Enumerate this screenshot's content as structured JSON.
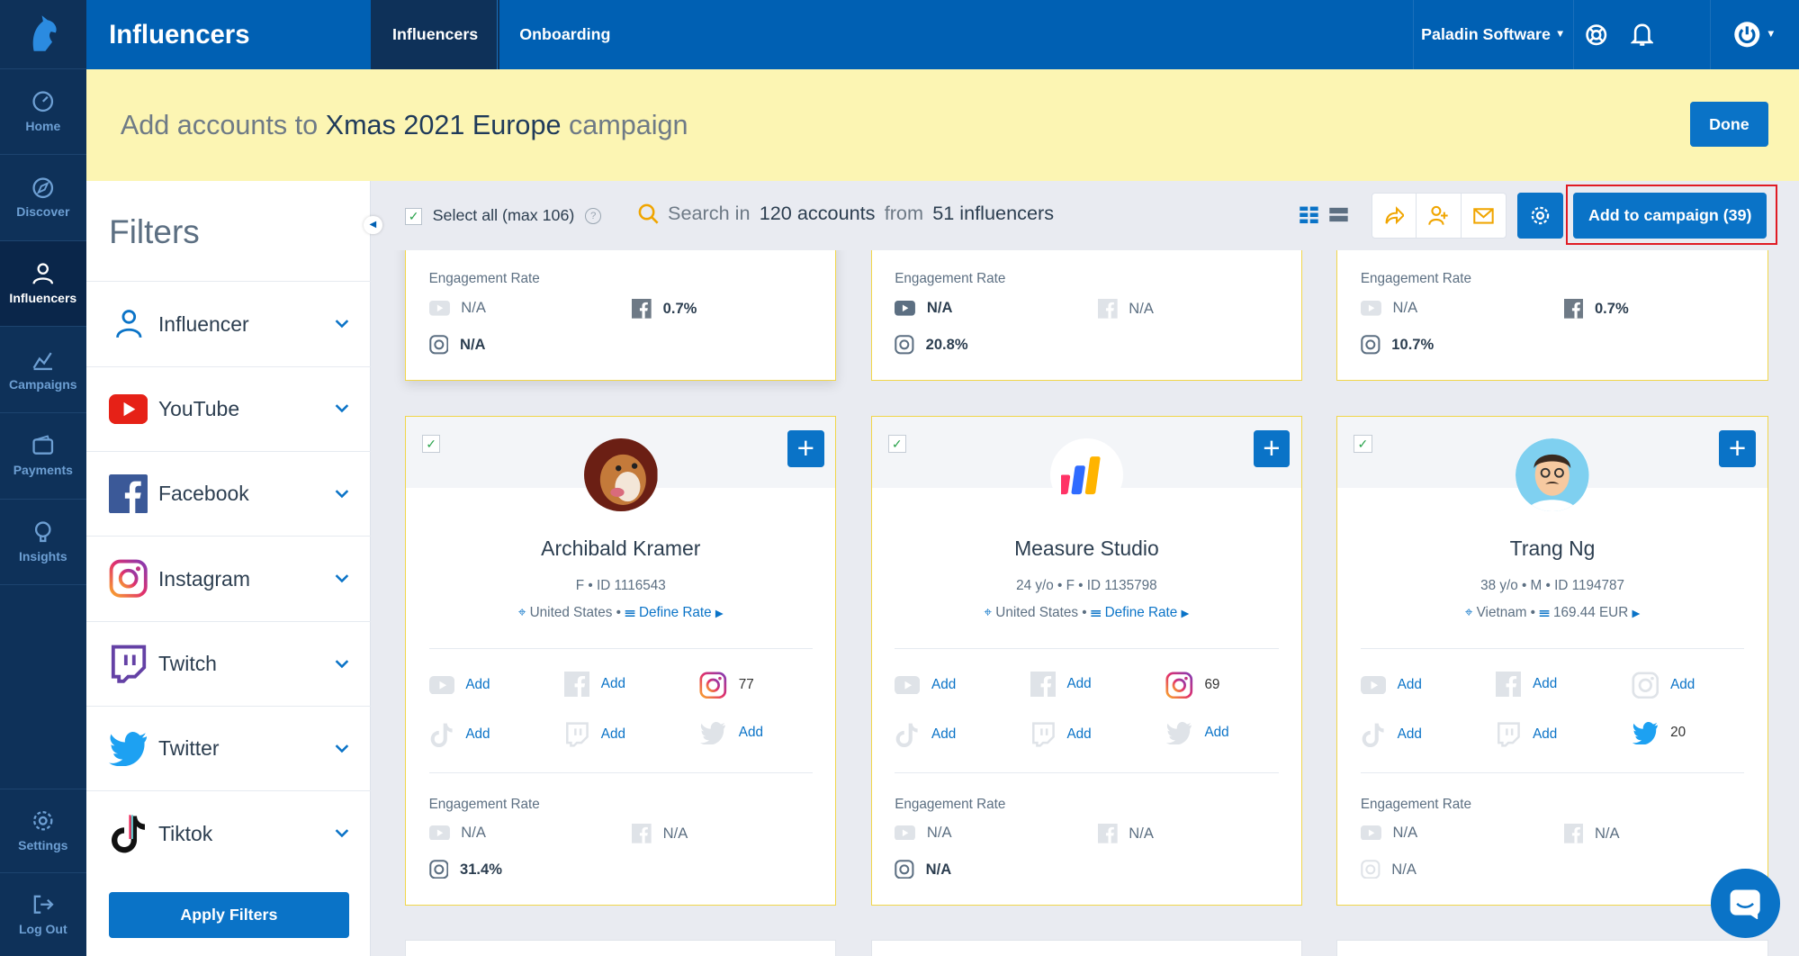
{
  "app": {
    "title": "Influencers"
  },
  "sidebar": {
    "items": [
      {
        "label": "Home",
        "icon": "gauge-icon"
      },
      {
        "label": "Discover",
        "icon": "compass-icon"
      },
      {
        "label": "Influencers",
        "icon": "user-icon"
      },
      {
        "label": "Campaigns",
        "icon": "chart-icon"
      },
      {
        "label": "Payments",
        "icon": "wallet-icon"
      },
      {
        "label": "Insights",
        "icon": "bulb-icon"
      }
    ],
    "bottom": [
      {
        "label": "Settings",
        "icon": "gear-icon"
      },
      {
        "label": "Log Out",
        "icon": "logout-icon"
      }
    ]
  },
  "topbar": {
    "tabs": [
      "Influencers",
      "Onboarding"
    ],
    "account": "Paladin Software"
  },
  "banner": {
    "prefix": "Add accounts to",
    "campaign": "Xmas 2021 Europe",
    "suffix": "campaign",
    "done": "Done"
  },
  "filters": {
    "title": "Filters",
    "items": [
      "Influencer",
      "YouTube",
      "Facebook",
      "Instagram",
      "Twitch",
      "Twitter",
      "Tiktok"
    ],
    "apply": "Apply Filters"
  },
  "toolbar": {
    "select_all": "Select all (max 106)",
    "help": "?",
    "search_a": "Search in",
    "accounts": "120 accounts",
    "search_b": "from",
    "influencers": "51 influencers",
    "add_to_campaign": "Add to campaign (39)"
  },
  "common": {
    "engagement_rate": "Engagement Rate",
    "add": "Add",
    "na": "N/A",
    "plus": "+",
    "check": "✓"
  },
  "top_cards": [
    {
      "r1a": "N/A",
      "r1b": "0.7%",
      "r2": "N/A"
    },
    {
      "r1a": "N/A",
      "r1b": "N/A",
      "r2": "20.8%"
    },
    {
      "r1a": "N/A",
      "r1b": "0.7%",
      "r2": "10.7%"
    }
  ],
  "cards": [
    {
      "name": "Archibald Kramer",
      "meta": "F • ID 1116543",
      "country": "United States",
      "rate": "Define Rate",
      "instagram": "77",
      "twitter": "Add",
      "er_youtube": "N/A",
      "er_facebook": "N/A",
      "er_third": "31.4%"
    },
    {
      "name": "Measure Studio",
      "meta": "24 y/o • F • ID 1135798",
      "country": "United States",
      "rate": "Define Rate",
      "instagram": "69",
      "twitter": "Add",
      "er_youtube": "N/A",
      "er_facebook": "N/A",
      "er_third": "N/A"
    },
    {
      "name": "Trang Ng",
      "meta": "38 y/o • M • ID 1194787",
      "country": "Vietnam",
      "rate": "169.44 EUR",
      "instagram": "Add",
      "twitter": "20",
      "er_youtube": "N/A",
      "er_facebook": "N/A",
      "er_third": "N/A"
    }
  ],
  "colors": {
    "primary": "#0060b3",
    "button": "#0a73c7",
    "sidebar": "#0e3159",
    "banner": "#fcf5b3",
    "card_border": "#f1d64a",
    "highlight": "#e01b24"
  }
}
